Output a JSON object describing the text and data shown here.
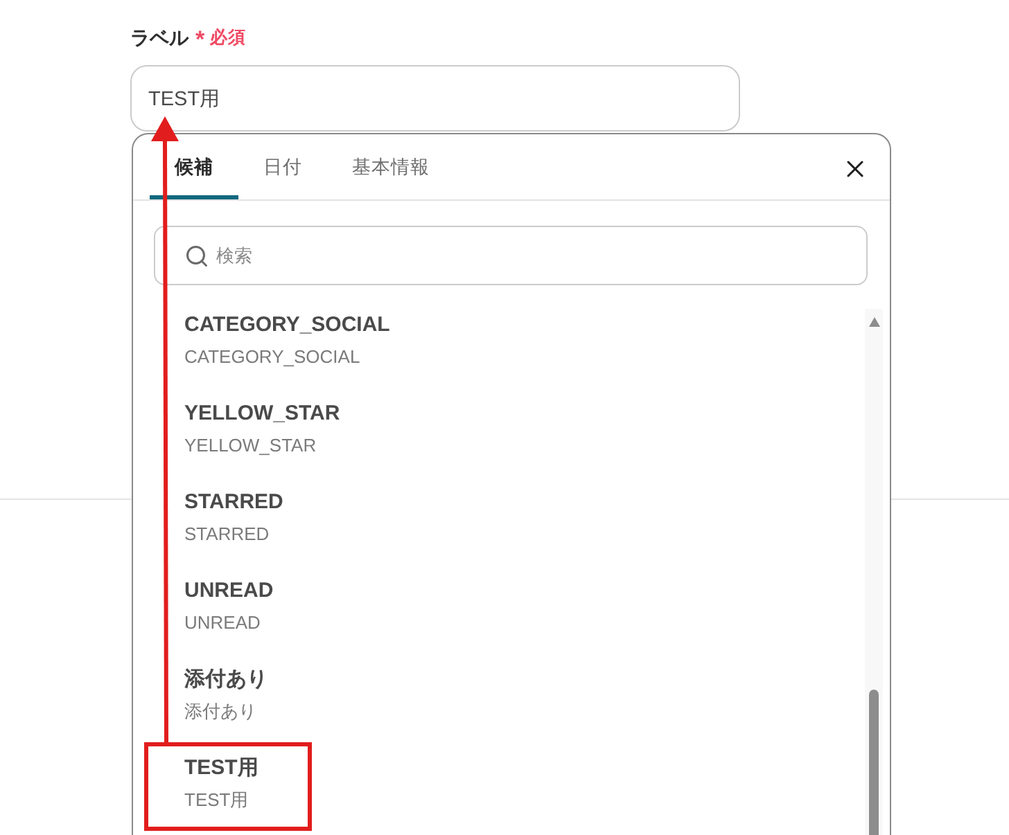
{
  "field": {
    "label": "ラベル",
    "required_mark": "*",
    "required_text": "必須",
    "value": "TEST用"
  },
  "popup": {
    "tabs": [
      {
        "label": "候補",
        "selected": true
      },
      {
        "label": "日付",
        "selected": false
      },
      {
        "label": "基本情報",
        "selected": false
      }
    ],
    "search": {
      "placeholder": "検索"
    },
    "suggestions": [
      {
        "title": "CATEGORY_SOCIAL",
        "value": "CATEGORY_SOCIAL",
        "highlighted": false
      },
      {
        "title": "YELLOW_STAR",
        "value": "YELLOW_STAR",
        "highlighted": false
      },
      {
        "title": "STARRED",
        "value": "STARRED",
        "highlighted": false
      },
      {
        "title": "UNREAD",
        "value": "UNREAD",
        "highlighted": false
      },
      {
        "title": "添付あり",
        "value": "添付あり",
        "highlighted": false
      },
      {
        "title": "TEST用",
        "value": "TEST用",
        "highlighted": true
      }
    ]
  }
}
